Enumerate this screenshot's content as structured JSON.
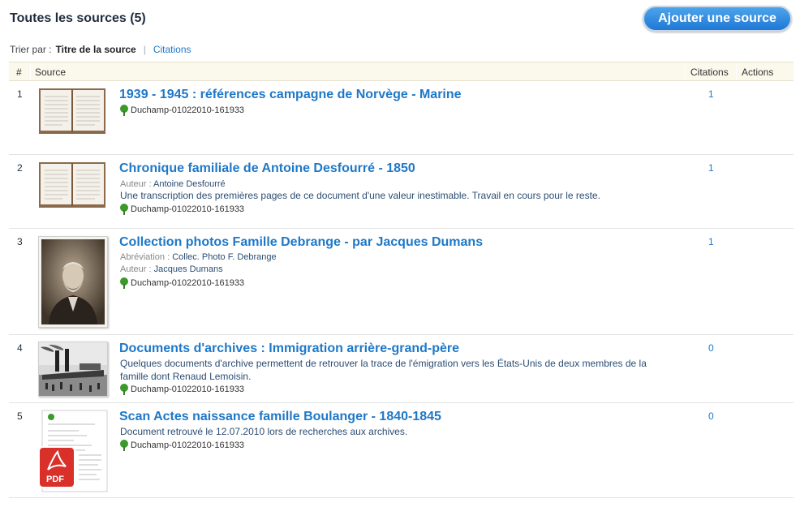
{
  "header": {
    "title": "Toutes les sources (5)",
    "add_button": "Ajouter une source"
  },
  "sort": {
    "label": "Trier par :",
    "active": "Titre de la source",
    "other": "Citations"
  },
  "table": {
    "columns": [
      "#",
      "Source",
      "Citations",
      "Actions"
    ]
  },
  "rows": [
    {
      "num": "1",
      "title": "1939 - 1945 : références campagne de Norvège - Marine",
      "tree": "Duchamp-01022010-161933",
      "citations": "1",
      "thumb": "open-book"
    },
    {
      "num": "2",
      "title": "Chronique familiale de Antoine Desfourré - 1850",
      "author_label": "Auteur :",
      "author": "Antoine Desfourré",
      "description": "Une transcription des premières pages de ce document d'une valeur inestimable. Travail en cours pour le reste.",
      "tree": "Duchamp-01022010-161933",
      "citations": "1",
      "thumb": "open-book"
    },
    {
      "num": "3",
      "title": "Collection photos Famille Debrange - par Jacques Dumans",
      "abbr_label": "Abréviation :",
      "abbr": "Collec. Photo F. Debrange",
      "author_label": "Auteur :",
      "author": "Jacques Dumans",
      "tree": "Duchamp-01022010-161933",
      "citations": "1",
      "thumb": "portrait-photo"
    },
    {
      "num": "4",
      "title": "Documents d'archives : Immigration arrière-grand-père",
      "description": "Quelques documents d'archive permettent de retrouver la trace de l'émigration vers les États-Unis de deux membres de la famille dont Renaud Lemoisin.",
      "tree": "Duchamp-01022010-161933",
      "citations": "0",
      "thumb": "steamboat-photo"
    },
    {
      "num": "5",
      "title": "Scan Actes naissance famille Boulanger - 1840-1845",
      "description": "Document retrouvé le 12.07.2010 lors de recherches aux archives.",
      "tree": "Duchamp-01022010-161933",
      "citations": "0",
      "thumb": "pdf-document",
      "pdf_label": "PDF"
    }
  ],
  "colors": {
    "link": "#1e78c8",
    "header_bg": "#fbf8ec",
    "button": "#2a86de",
    "tree": "#3a9a2a",
    "pdf": "#d9302a"
  }
}
